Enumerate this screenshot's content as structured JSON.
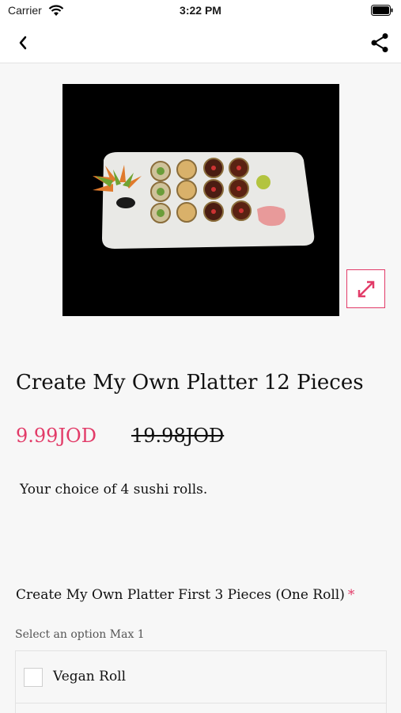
{
  "status_bar": {
    "carrier": "Carrier",
    "time": "3:22 PM"
  },
  "nav": {
    "back_icon": "chevron-left-icon",
    "share_icon": "share-icon"
  },
  "product": {
    "image_alt": "sushi platter",
    "title": "Create My Own Platter 12 Pieces",
    "price": "9.99JOD",
    "original_price": "19.98JOD",
    "description": "Your choice of 4 sushi rolls."
  },
  "options": {
    "group_title": "Create My Own Platter First 3 Pieces (One Roll)",
    "required_mark": "*",
    "hint": "Select an option Max 1",
    "items": [
      {
        "label": "Vegan Roll",
        "checked": false
      }
    ]
  },
  "colors": {
    "accent": "#e23b68",
    "background": "#f7f7f7"
  }
}
